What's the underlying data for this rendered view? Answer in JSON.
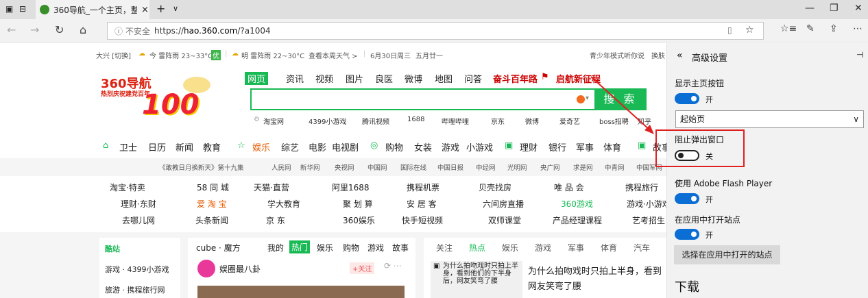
{
  "browser": {
    "tab_title": "360导航_一个主页，整个",
    "tab_close": "×",
    "new_tab": "+",
    "tab_list": "∨",
    "window_min": "—",
    "window_restore": "❐",
    "window_close": "✕",
    "security_label": "不安全",
    "url_prefix": "https://",
    "url_host": "hao.360.com",
    "url_path": "/?a1004",
    "reading_view_icon": "book-icon",
    "favorite_icon": "star-icon"
  },
  "weather": {
    "city": "大兴 [切换]",
    "today": "今 雷阵雨 23~33°C",
    "aq": "优",
    "tomorrow": "明 雷阵雨 22~30°C",
    "forecast_link": "查看本周天气 >",
    "date": "6月30日周三",
    "lunar": "五月廿一",
    "youth_mode": "青少年模式听你说",
    "skin": "换肤"
  },
  "logo": {
    "brand": "360导航",
    "slogan": "热烈庆祝建党百年",
    "number": "100"
  },
  "search": {
    "tabs": [
      "网页",
      "资讯",
      "视频",
      "图片",
      "良医",
      "微博",
      "地图",
      "问答"
    ],
    "promo_a": "奋斗百年路",
    "promo_b": "启航新征程",
    "button": "搜 索",
    "quick_links": [
      "淘宝网",
      "4399小游戏",
      "腾讯视频",
      "1688",
      "哔哩哔哩",
      "京东",
      "微博",
      "爱奇艺",
      "boss招聘",
      "知乎"
    ]
  },
  "categories": [
    "卫士",
    "日历",
    "新闻",
    "教育",
    "娱乐",
    "综艺",
    "电影",
    "电视剧",
    "购物",
    "女装",
    "游戏",
    "小游戏",
    "理财",
    "银行",
    "军事",
    "体育",
    "故事"
  ],
  "media_bar": [
    "《敢教日月换新天》第十九集",
    "人民网",
    "新华网",
    "央视网",
    "中国网",
    "国际在线",
    "中国日报",
    "中经网",
    "光明网",
    "央广网",
    "求是网",
    "中青网",
    "中国军网"
  ],
  "links": {
    "row1": [
      "淘宝·特卖",
      "58 同 城",
      "天猫·直营",
      "阿里1688",
      "携程机票",
      "贝壳找房",
      "唯 品 会",
      "携程旅行"
    ],
    "row2": [
      "理财·东财",
      "爱 淘 宝",
      "学大教育",
      "聚 划 算",
      "安 居 客",
      "六间房直播",
      "360游戏",
      "游戏·小游戏"
    ],
    "row3": [
      "去哪儿网",
      "头条新闻",
      "京 东",
      "360娱乐",
      "快手短视频",
      "双师课堂",
      "产品经理课程",
      "艺考招生"
    ]
  },
  "lower": {
    "side_title": "酷站",
    "side_items": [
      "游戏 · 4399小游戏",
      "旅游 · 携程旅行网"
    ],
    "feed_tabs": [
      "cube · 魔方",
      "我的",
      "热门",
      "娱乐",
      "购物",
      "游戏",
      "故事"
    ],
    "feed_author": "娱圈最八卦",
    "follow": "+关注",
    "news_tabs": [
      "关注",
      "热点",
      "娱乐",
      "游戏",
      "军事",
      "体育",
      "汽车"
    ],
    "news_thumb_text": "为什么拍吻戏时只拍上半身，看到他们的下半身后，网友笑弯了腰",
    "news_headline_1": "为什么拍吻戏时只拍上半身，看到",
    "news_headline_2": "网友笑弯了腰"
  },
  "settings_panel": {
    "back": "«",
    "title": "高级设置",
    "pin": "⊣",
    "show_home_label": "显示主页按钮",
    "show_home_state": "开",
    "home_select": "起始页",
    "block_popups_label": "阻止弹出窗口",
    "block_popups_state": "关",
    "flash_label": "使用 Adobe Flash Player",
    "flash_state": "开",
    "open_in_app_label": "在应用中打开站点",
    "open_in_app_state": "开",
    "choose_sites_button": "选择在应用中打开的站点",
    "downloads_heading": "下载"
  },
  "colors": {
    "accent_green": "#19b955",
    "toggle_blue": "#0b6ed4",
    "highlight_red": "#e02020"
  }
}
